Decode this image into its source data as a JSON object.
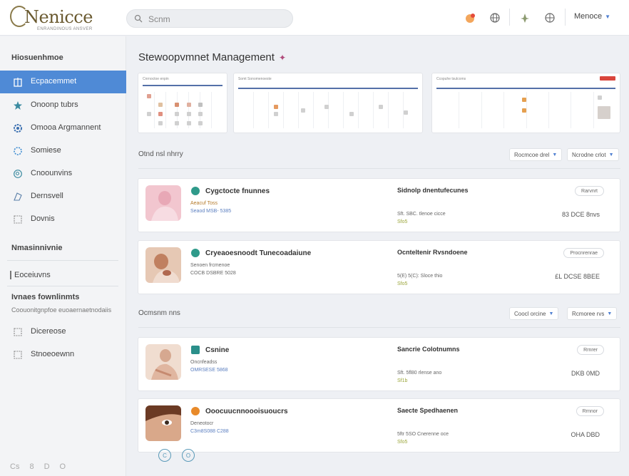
{
  "header": {
    "logo_name": "Nenicce",
    "logo_tagline": "ENRANDINOUS ANSVER",
    "search_placeholder": "Scnm",
    "user_name": "Menoce"
  },
  "sidebar": {
    "section1_title": "Hiosuenhmoe",
    "items": [
      {
        "label": "Ecpacemmet",
        "icon": "building-icon"
      },
      {
        "label": "Onoonp tubrs",
        "icon": "star-icon"
      },
      {
        "label": "Omooa Argmannent",
        "icon": "gear-icon"
      },
      {
        "label": "Somiese",
        "icon": "cog-icon"
      },
      {
        "label": "Cnoounvins",
        "icon": "search-icon"
      },
      {
        "label": "Dernsvell",
        "icon": "shapes-icon"
      },
      {
        "label": "Dovnis",
        "icon": "frame-icon"
      }
    ],
    "section2_title": "Nmasinnivnie",
    "section3_title": "Eoceiuvns",
    "section4_title": "Ivnaes fownlinmts",
    "section4_desc": "Coouonitgnpfoe euoaernaetnodaiis",
    "items2": [
      {
        "label": "Dicereose",
        "icon": "frame-icon"
      },
      {
        "label": "Stnoeoewnn",
        "icon": "frame-icon"
      }
    ],
    "footer": [
      "Cs",
      "8",
      "D",
      "O"
    ]
  },
  "main": {
    "title": "Stewoopvmnet Management",
    "calendars": [
      {
        "title": "Cnrnoctoe enpin"
      },
      {
        "title": "Somt Sonomenoeste"
      },
      {
        "title": "Ccopuhe tsulcoms"
      }
    ],
    "group1": {
      "title": "Otnd nsl nhrry",
      "filter1": "Rocmcoe drel",
      "filter2": "Ncrodne crlot"
    },
    "group2": {
      "title": "Ocmsnm nns",
      "filter1": "Coocl orcine",
      "filter2": "Rcmoree rvs"
    },
    "rows": [
      {
        "name": "Cygctocte fnunnes",
        "sub1": "Aeacuf Toss",
        "sub2": "Seaod MSB- 5385",
        "mid": "Sidnolp dnentufecunes",
        "midsub": "Sft. SBC. tlenoe cicce",
        "midsub2": "Sfo5",
        "status": "Rarvnrt",
        "amount": "83 DCE 8nvs"
      },
      {
        "name": "Cryeaoesnoodt Tunecoadaiune",
        "sub1": "Senoen frcmenoe",
        "sub2": "COCB DSBRE 5028",
        "mid": "Ocnteltenir Rvsndoene",
        "midsub": "5(E) 5(C): Sloce thio",
        "midsub2": "Sfo5",
        "status": "Procnrenrae",
        "amount": "£L DCSE 8BEE"
      },
      {
        "name": "Csnine",
        "sub1": "Oncnfeadss",
        "sub2": "OMRSESE 5868",
        "mid": "Sancrie Colotnumns",
        "midsub": "Sft. 5fl80 rlense ano",
        "midsub2": "Sf1b",
        "status": "Rrnrer",
        "amount": "DKB 0MD"
      },
      {
        "name": "Ooocuucnnoooisuoucrs",
        "sub1": "Deneotocr",
        "sub2": "C3m8S088 C288",
        "mid": "Saecte Spedhaenen",
        "midsub": "5ftr 5SO Cnerenne oce",
        "midsub2": "Sfo5",
        "status": "Rrnnor",
        "amount": "OHA DBD"
      }
    ],
    "pager": [
      "C",
      "O"
    ]
  },
  "colors": {
    "accent": "#4f8ad6",
    "calendar_bar": "#5470a8",
    "badge_red": "#d9453b"
  }
}
